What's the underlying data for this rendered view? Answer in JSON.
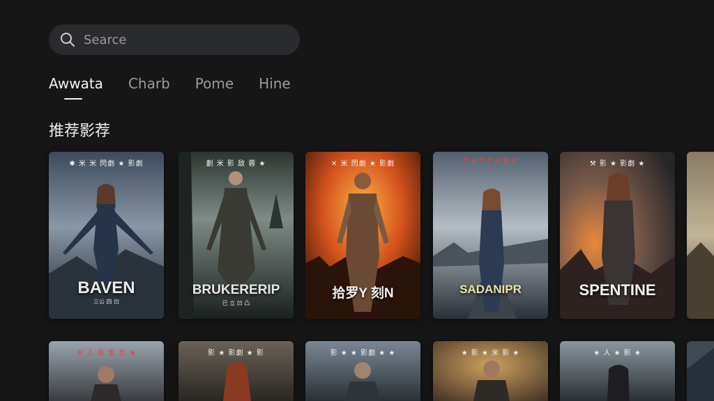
{
  "search": {
    "placeholder": "Searce",
    "icon": "search-icon"
  },
  "tabs": [
    {
      "label": "Awwata",
      "active": true
    },
    {
      "label": "Charb",
      "active": false
    },
    {
      "label": "Pome",
      "active": false
    },
    {
      "label": "Hine",
      "active": false
    }
  ],
  "section": {
    "title": "推荐影荐"
  },
  "posters_row1": [
    {
      "credits": "✱ 米 米 閃劇 ★ 影劇",
      "title": "BAVEN",
      "subtitle": "三公 四 凹",
      "theme": "storm-blue"
    },
    {
      "credits": "劃 米 影 敌 蓉 ★",
      "title": "BRUKERERIP",
      "subtitle": "已 立 凹 凸",
      "theme": "forest-green"
    },
    {
      "credits": "✕ 米 閃劇 ★ 影劇",
      "title": "拾罗Y 刻N",
      "subtitle": "",
      "theme": "fire-orange"
    },
    {
      "credits": "F A F F A R K",
      "title": "SADANIPR",
      "subtitle": "",
      "theme": "road-grey"
    },
    {
      "credits": "⚒ 影 ★ 影劇 ★",
      "title": "SPENTINE",
      "subtitle": "",
      "theme": "ember-red"
    }
  ],
  "posters_row2": [
    {
      "credits": "米 人 影   愛 氏 ★",
      "theme": "dusk"
    },
    {
      "credits": "影 ★ 影劇 ★ 影",
      "theme": "haze"
    },
    {
      "credits": "影 ★ ★ 影劇 ★ ★",
      "theme": "cloud"
    },
    {
      "credits": "★ 影 ★ 米 影 ★",
      "theme": "amber"
    },
    {
      "credits": "★ 人 ★ 影 ★",
      "theme": "steel"
    }
  ],
  "colors": {
    "background": "#161617",
    "search_bg": "#2a2b2e",
    "tab_active": "#f2f2f2",
    "tab_inactive": "#9b9b9f"
  }
}
